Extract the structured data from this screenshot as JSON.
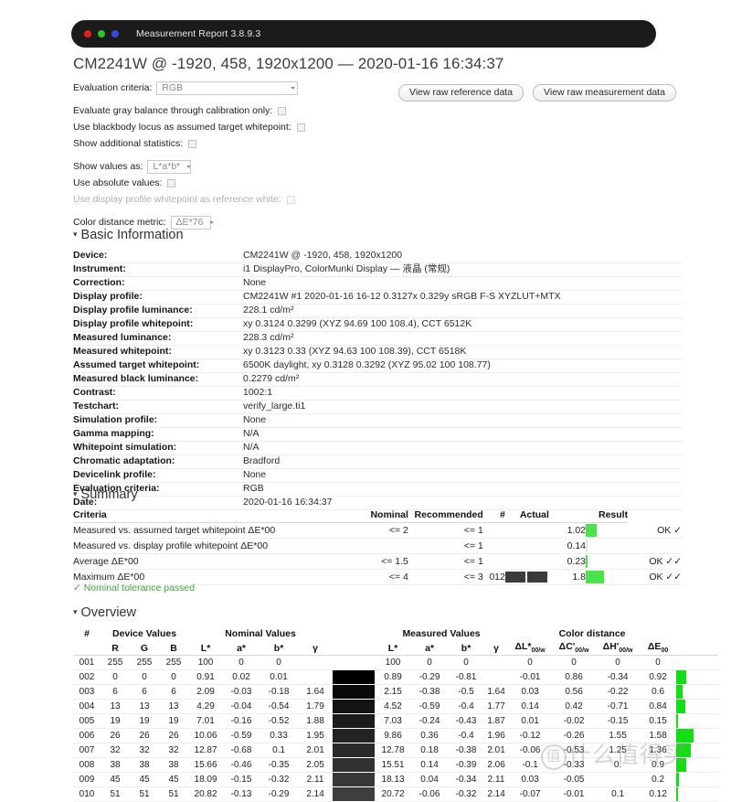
{
  "window": {
    "title": "Measurement Report 3.8.9.3",
    "dots": [
      "red",
      "green",
      "blue"
    ]
  },
  "report": {
    "title": "CM2241W @ -1920, 458, 1920x1200 — 2020-01-16 16:34:37"
  },
  "options": {
    "evaluation_criteria_label": "Evaluation criteria:",
    "evaluation_criteria_value": "RGB",
    "gray_balance_label": "Evaluate gray balance through calibration only:",
    "blackbody_label": "Use blackbody locus as assumed target whitepoint:",
    "additional_stats_label": "Show additional statistics:",
    "show_values_label": "Show values as:",
    "show_values_value": "L*a*b*",
    "absolute_values_label": "Use absolute values:",
    "profile_whitepoint_label": "Use display profile whitepoint as reference white:",
    "color_distance_label": "Color distance metric:",
    "color_distance_value": "ΔE*76",
    "caret": "▾"
  },
  "buttons": {
    "view_raw_reference": "View raw reference data",
    "view_raw_measurement": "View raw measurement data"
  },
  "basic_information": {
    "heading": "Basic Information",
    "triangle": "▾",
    "rows": [
      {
        "key": "Device:",
        "value": "CM2241W @ -1920, 458, 1920x1200"
      },
      {
        "key": "Instrument:",
        "value": "i1 DisplayPro, ColorMunki Display — 液晶 (常规)"
      },
      {
        "key": "Correction:",
        "value": "None"
      },
      {
        "key": "Display profile:",
        "value": "CM2241W #1 2020-01-16 16-12 0.3127x 0.329y sRGB F-S XYZLUT+MTX"
      },
      {
        "key": "Display profile luminance:",
        "value": "228.1 cd/m²"
      },
      {
        "key": "Display profile whitepoint:",
        "value": "xy 0.3124 0.3299 (XYZ 94.69 100 108.4), CCT 6512K"
      },
      {
        "key": "Measured luminance:",
        "value": "228.3 cd/m²"
      },
      {
        "key": "Measured whitepoint:",
        "value": "xy 0.3123 0.33 (XYZ 94.63 100 108.39), CCT 6518K"
      },
      {
        "key": "Assumed target whitepoint:",
        "value": "6500K daylight, xy 0.3128 0.3292 (XYZ 95.02 100 108.77)"
      },
      {
        "key": "Measured black luminance:",
        "value": "0.2279 cd/m²"
      },
      {
        "key": "Contrast:",
        "value": "1002:1"
      },
      {
        "key": "Testchart:",
        "value": "verify_large.ti1"
      },
      {
        "key": "Simulation profile:",
        "value": "None"
      },
      {
        "key": "Gamma mapping:",
        "value": "N/A"
      },
      {
        "key": "Whitepoint simulation:",
        "value": "N/A"
      },
      {
        "key": "Chromatic adaptation:",
        "value": "Bradford"
      },
      {
        "key": "Devicelink profile:",
        "value": "None"
      },
      {
        "key": "Evaluation criteria:",
        "value": "RGB"
      },
      {
        "key": "Date:",
        "value": "2020-01-16 16:34:37"
      }
    ]
  },
  "summary": {
    "heading": "Summary",
    "triangle": "▾",
    "columns": [
      "Criteria",
      "Nominal",
      "Recommended",
      "#",
      "Actual",
      "Result"
    ],
    "rows": [
      {
        "criteria": "Measured vs. assumed target whitepoint ΔE*00",
        "nominal": "<= 2",
        "recommended": "<= 1",
        "hash": "",
        "swatches": [],
        "actual": "1.02",
        "bar": 12,
        "result": "OK ✓"
      },
      {
        "criteria": "Measured vs. display profile whitepoint ΔE*00",
        "nominal": "",
        "recommended": "<= 1",
        "hash": "",
        "swatches": [],
        "actual": "0.14",
        "bar": 0,
        "result": ""
      },
      {
        "criteria": "Average ΔE*00",
        "nominal": "<= 1.5",
        "recommended": "<= 1",
        "hash": "",
        "swatches": [],
        "actual": "0.23",
        "bar": 2,
        "result": "OK ✓✓"
      },
      {
        "criteria": "Maximum ΔE*00",
        "nominal": "<= 4",
        "recommended": "<= 3",
        "hash": "012",
        "swatches": [
          "#3b3b3b",
          "#3b3b3b"
        ],
        "actual": "1.8",
        "bar": 20,
        "result": "OK ✓✓"
      }
    ],
    "tolerance_note": "✓ Nominal tolerance passed"
  },
  "overview": {
    "heading": "Overview",
    "triangle": "▾",
    "group_headers": [
      "#",
      "Device Values",
      "Nominal Values",
      "Measured Values",
      "Color distance"
    ],
    "sub_headers": [
      "",
      "R",
      "G",
      "B",
      "L*",
      "a*",
      "b*",
      "γ",
      "",
      "L*",
      "a*",
      "b*",
      "γ",
      "ΔL*",
      "ΔC'",
      "ΔH'",
      "ΔE"
    ],
    "sub_subscripts": [
      "",
      "",
      "",
      "",
      "",
      "",
      "",
      "",
      "",
      "",
      "",
      "",
      "",
      "00/w",
      "00/w",
      "00/w",
      "00"
    ],
    "rows": [
      {
        "n": "001",
        "R": "255",
        "G": "255",
        "B": "255",
        "nL": "100",
        "na": "0",
        "nb": "0",
        "ng": "",
        "swatch": "#ffffff",
        "mL": "100",
        "ma": "0",
        "mb": "0",
        "mg": "",
        "dL": "0",
        "dC": "0",
        "dH": "0",
        "dE": "0",
        "bar": 0
      },
      {
        "n": "002",
        "R": "0",
        "G": "0",
        "B": "0",
        "nL": "0.91",
        "na": "0.02",
        "nb": "0.01",
        "ng": "",
        "swatch": "#000000",
        "mL": "0.89",
        "ma": "-0.29",
        "mb": "-0.81",
        "mg": "",
        "dL": "-0.01",
        "dC": "0.86",
        "dH": "-0.34",
        "dE": "0.92",
        "bar": 11
      },
      {
        "n": "003",
        "R": "6",
        "G": "6",
        "B": "6",
        "nL": "2.09",
        "na": "-0.03",
        "nb": "-0.18",
        "ng": "1.64",
        "swatch": "#0a0a0a",
        "mL": "2.15",
        "ma": "-0.38",
        "mb": "-0.5",
        "mg": "1.64",
        "dL": "0.03",
        "dC": "0.56",
        "dH": "-0.22",
        "dE": "0.6",
        "bar": 7
      },
      {
        "n": "004",
        "R": "13",
        "G": "13",
        "B": "13",
        "nL": "4.29",
        "na": "-0.04",
        "nb": "-0.54",
        "ng": "1.79",
        "swatch": "#131313",
        "mL": "4.52",
        "ma": "-0.59",
        "mb": "-0.4",
        "mg": "1.77",
        "dL": "0.14",
        "dC": "0.42",
        "dH": "-0.71",
        "dE": "0.84",
        "bar": 10
      },
      {
        "n": "005",
        "R": "19",
        "G": "19",
        "B": "19",
        "nL": "7.01",
        "na": "-0.16",
        "nb": "-0.52",
        "ng": "1.88",
        "swatch": "#1b1b1b",
        "mL": "7.03",
        "ma": "-0.24",
        "mb": "-0.43",
        "mg": "1.87",
        "dL": "0.01",
        "dC": "-0.02",
        "dH": "-0.15",
        "dE": "0.15",
        "bar": 2
      },
      {
        "n": "006",
        "R": "26",
        "G": "26",
        "B": "26",
        "nL": "10.06",
        "na": "-0.59",
        "nb": "0.33",
        "ng": "1.95",
        "swatch": "#232323",
        "mL": "9.86",
        "ma": "0.36",
        "mb": "-0.4",
        "mg": "1.96",
        "dL": "-0.12",
        "dC": "-0.26",
        "dH": "1.55",
        "dE": "1.58",
        "bar": 19
      },
      {
        "n": "007",
        "R": "32",
        "G": "32",
        "B": "32",
        "nL": "12.87",
        "na": "-0.68",
        "nb": "0.1",
        "ng": "2.01",
        "swatch": "#2a2a2a",
        "mL": "12.78",
        "ma": "0.18",
        "mb": "-0.38",
        "mg": "2.01",
        "dL": "-0.06",
        "dC": "-0.53",
        "dH": "1.25",
        "dE": "1.36",
        "bar": 16
      },
      {
        "n": "008",
        "R": "38",
        "G": "38",
        "B": "38",
        "nL": "15.66",
        "na": "-0.46",
        "nb": "-0.35",
        "ng": "2.05",
        "swatch": "#313131",
        "mL": "15.51",
        "ma": "0.14",
        "mb": "-0.39",
        "mg": "2.06",
        "dL": "-0.1",
        "dC": "-0.33",
        "dH": "0.",
        "dE": "0.9",
        "bar": 11
      },
      {
        "n": "009",
        "R": "45",
        "G": "45",
        "B": "45",
        "nL": "18.09",
        "na": "-0.15",
        "nb": "-0.32",
        "ng": "2.11",
        "swatch": "#383838",
        "mL": "18.13",
        "ma": "0.04",
        "mb": "-0.34",
        "mg": "2.11",
        "dL": "0.03",
        "dC": "-0.05",
        "dH": "",
        "dE": "0.2",
        "bar": 3
      },
      {
        "n": "010",
        "R": "51",
        "G": "51",
        "B": "51",
        "nL": "20.82",
        "na": "-0.13",
        "nb": "-0.29",
        "ng": "2.14",
        "swatch": "#3e3e3e",
        "mL": "20.72",
        "ma": "-0.06",
        "mb": "-0.32",
        "mg": "2.14",
        "dL": "-0.07",
        "dC": "-0.01",
        "dH": "0.1",
        "dE": "0.12",
        "bar": 2
      }
    ]
  },
  "watermark": {
    "mark": "值",
    "text": "什么值得买"
  },
  "colors": {
    "titlebar_bg": "#1b1b1b",
    "green_pass": "#3fa33f",
    "green_bar": "#15dd15",
    "text": "#1a1a1a"
  }
}
